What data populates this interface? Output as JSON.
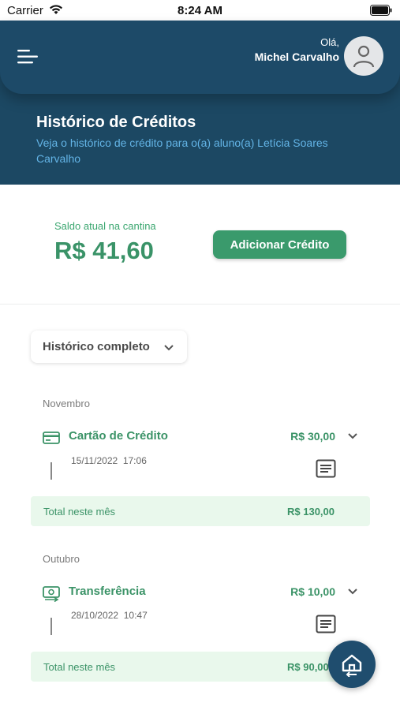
{
  "status_bar": {
    "carrier": "Carrier",
    "time": "8:24 AM"
  },
  "header": {
    "greeting": "Olá,",
    "user_name": "Michel Carvalho",
    "title": "Histórico de Créditos",
    "subtitle": "Veja o histórico de crédito para o(a) aluno(a) Letícia Soares Carvalho"
  },
  "balance": {
    "label": "Saldo atual na cantina",
    "value": "R$ 41,60",
    "add_button": "Adicionar Crédito"
  },
  "filter": {
    "selected": "Histórico completo"
  },
  "months": [
    {
      "name": "Novembro",
      "transactions": [
        {
          "type": "Cartão de Crédito",
          "amount": "R$ 30,00",
          "datetime": "15/11/2022  17:06",
          "icon": "credit-card-icon"
        }
      ],
      "total_label": "Total neste mês",
      "total_value": "R$ 130,00"
    },
    {
      "name": "Outubro",
      "transactions": [
        {
          "type": "Transferência",
          "amount": "R$ 10,00",
          "datetime": "28/10/2022  10:47",
          "icon": "money-transfer-icon"
        }
      ],
      "total_label": "Total neste mês",
      "total_value": "R$ 90,00"
    }
  ],
  "colors": {
    "header": "#1d4a68",
    "accent_green": "#3a9a6c",
    "total_bg": "#e9f8ec",
    "subtitle": "#63b4e6"
  }
}
